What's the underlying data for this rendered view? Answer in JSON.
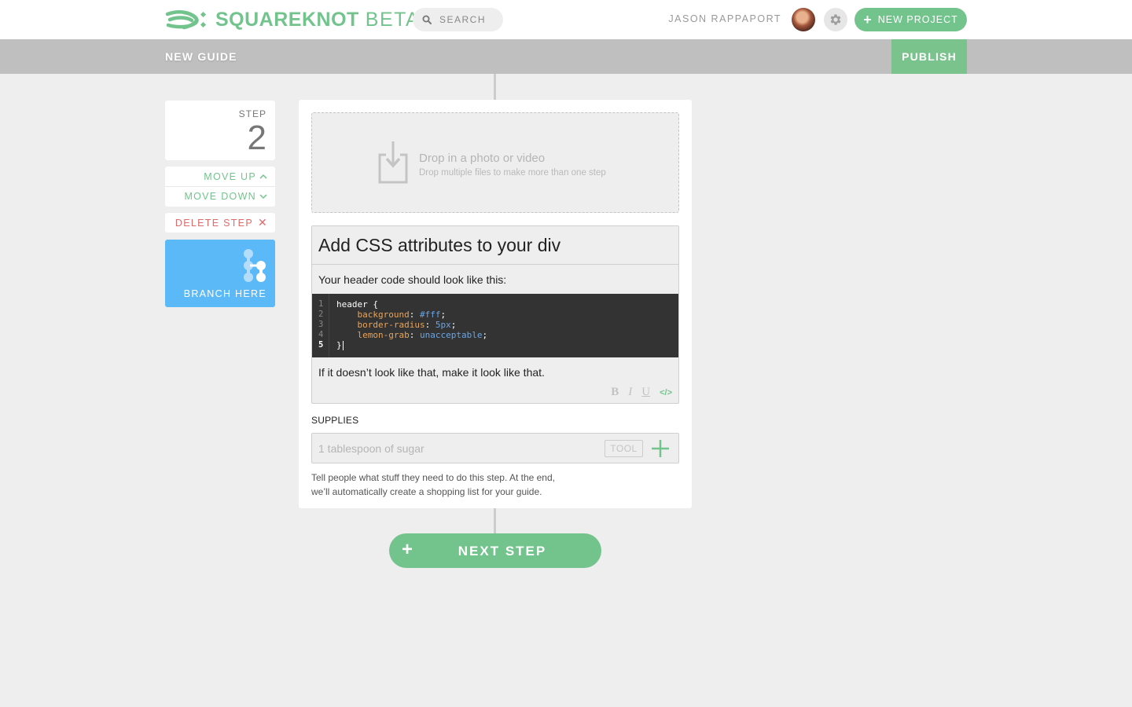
{
  "app": {
    "brand": "SQUAREKNOT",
    "badge": "BETA",
    "accent_color": "#72c48c",
    "danger_color": "#e06a6a",
    "branch_color": "#5bb9f7"
  },
  "header": {
    "search_placeholder": "SEARCH",
    "user_name": "JASON RAPPAPORT",
    "new_project_label": "NEW PROJECT",
    "icons": [
      "knot-logo-icon",
      "search-icon",
      "avatar",
      "gear-icon",
      "plus-icon"
    ]
  },
  "guidebar": {
    "title": "NEW GUIDE",
    "publish_label": "PUBLISH"
  },
  "step_controls": {
    "step_label": "STEP",
    "step_number": "2",
    "move_up_label": "MOVE UP",
    "move_up_icon": "^",
    "move_down_label": "MOVE DOWN",
    "move_down_icon": "v",
    "delete_label": "DELETE STEP",
    "delete_icon": "✕",
    "branch_label": "BRANCH HERE"
  },
  "step": {
    "dropzone": {
      "title": "Drop in a photo or video",
      "subtitle": "Drop multiple files to make more than one step"
    },
    "title": "Add CSS attributes to your div",
    "intro": "Your header code should look like this:",
    "code": {
      "line_numbers": [
        "1",
        "2",
        "3",
        "4",
        "5"
      ],
      "active_line": "5",
      "lines": [
        [
          {
            "t": "plain",
            "v": "header {"
          }
        ],
        [
          {
            "t": "plain",
            "v": "    "
          },
          {
            "t": "prop",
            "v": "background"
          },
          {
            "t": "plain",
            "v": ": "
          },
          {
            "t": "val",
            "v": "#fff"
          },
          {
            "t": "plain",
            "v": ";"
          }
        ],
        [
          {
            "t": "plain",
            "v": "    "
          },
          {
            "t": "prop",
            "v": "border-radius"
          },
          {
            "t": "plain",
            "v": ": "
          },
          {
            "t": "val",
            "v": "5px"
          },
          {
            "t": "plain",
            "v": ";"
          }
        ],
        [
          {
            "t": "plain",
            "v": "    "
          },
          {
            "t": "prop",
            "v": "lemon-grab"
          },
          {
            "t": "plain",
            "v": ": "
          },
          {
            "t": "val",
            "v": "unacceptable"
          },
          {
            "t": "plain",
            "v": ";"
          }
        ],
        [
          {
            "t": "plain",
            "v": "}"
          }
        ]
      ]
    },
    "outro": "If it doesn’t look like that, make it look like that.",
    "format_buttons": {
      "bold": "B",
      "italic": "I",
      "underline": "U",
      "code": "</>"
    },
    "supplies": {
      "label": "SUPPLIES",
      "input_value": "",
      "input_placeholder": "1 tablespoon of sugar",
      "tool_label": "TOOL",
      "help_line1": "Tell people what stuff they need to do this step. At the end,",
      "help_line2": "we’ll automatically create a shopping list for your guide."
    }
  },
  "next_step_label": "NEXT STEP"
}
